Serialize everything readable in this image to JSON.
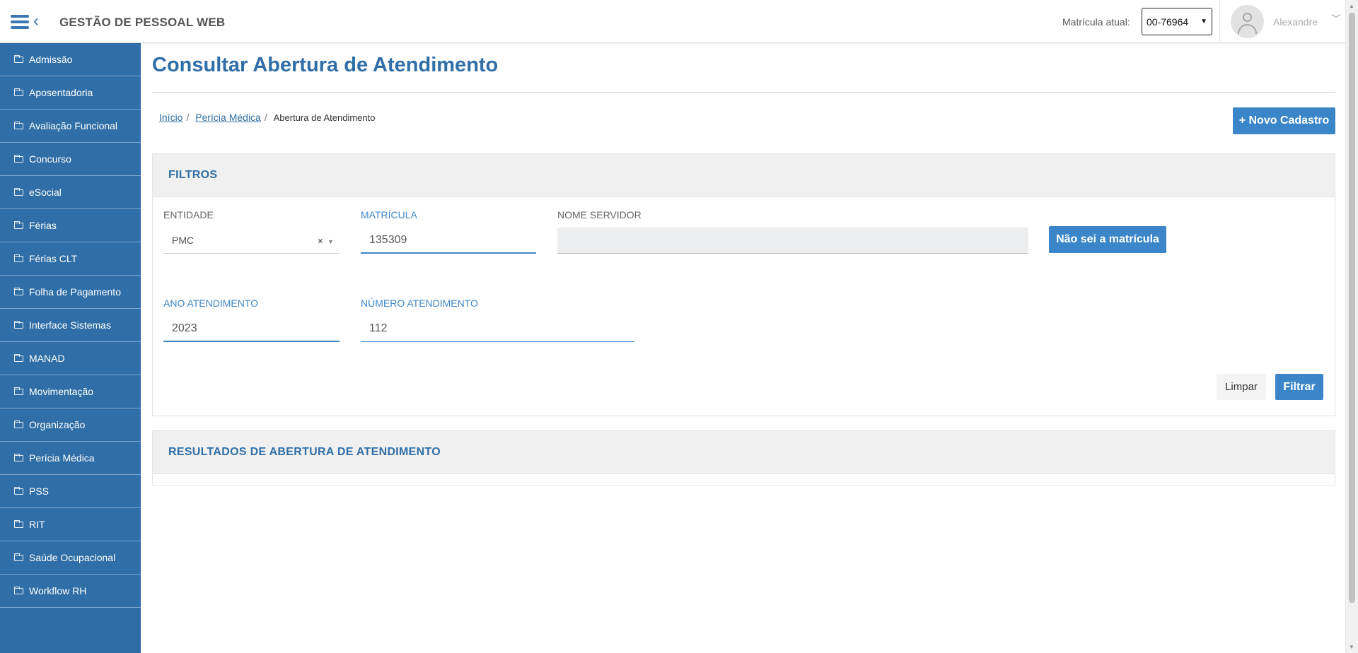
{
  "header": {
    "app_title": "GESTÃO DE PESSOAL WEB",
    "matricula_label": "Matrícula atual:",
    "matricula_selected": "00-76964",
    "user_name": "Alexandre"
  },
  "sidebar": {
    "items": [
      {
        "label": "Admissão"
      },
      {
        "label": "Aposentadoria"
      },
      {
        "label": "Avaliação Funcional"
      },
      {
        "label": "Concurso"
      },
      {
        "label": "eSocial"
      },
      {
        "label": "Férias"
      },
      {
        "label": "Férias CLT"
      },
      {
        "label": "Folha de Pagamento"
      },
      {
        "label": "Interface Sistemas"
      },
      {
        "label": "MANAD"
      },
      {
        "label": "Movimentação"
      },
      {
        "label": "Organização"
      },
      {
        "label": "Perícia Médica"
      },
      {
        "label": "PSS"
      },
      {
        "label": "RIT"
      },
      {
        "label": "Saúde Ocupacional"
      },
      {
        "label": "Workflow RH"
      }
    ]
  },
  "page": {
    "title": "Consultar Abertura de Atendimento",
    "breadcrumb": {
      "home": "Início",
      "section": "Perícia Médica",
      "current": "Abertura de Atendimento"
    },
    "new_button": "+ Novo Cadastro"
  },
  "filters": {
    "title": "FILTROS",
    "entidade_label": "ENTIDADE",
    "entidade_value": "PMC",
    "matricula_label": "MATRÍCULA",
    "matricula_value": "135309",
    "nome_label": "NOME SERVIDOR",
    "nome_value": "",
    "nao_sei_button": "Não sei a matrícula",
    "ano_label": "ANO ATENDIMENTO",
    "ano_value": "2023",
    "numero_label": "NÚMERO ATENDIMENTO",
    "numero_value": "112",
    "clear_button": "Limpar",
    "filter_button": "Filtrar"
  },
  "results": {
    "title": "RESULTADOS DE ABERTURA DE ATENDIMENTO"
  },
  "colors": {
    "primary": "#2f6ea6",
    "button": "#3b86c8"
  }
}
